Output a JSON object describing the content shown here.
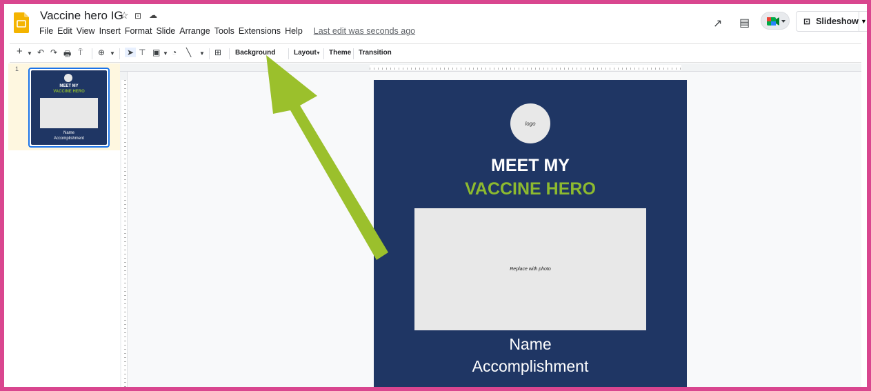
{
  "header": {
    "title": "Vaccine hero IG",
    "menu": [
      "File",
      "Edit",
      "View",
      "Insert",
      "Format",
      "Slide",
      "Arrange",
      "Tools",
      "Extensions",
      "Help"
    ],
    "last_edit": "Last edit was seconds ago",
    "slideshow_label": "Slideshow"
  },
  "toolbar": {
    "background_label": "Background",
    "layout_label": "Layout",
    "theme_label": "Theme",
    "transition_label": "Transition"
  },
  "filmstrip": {
    "slide_number": "1",
    "thumb_title1": "MEET MY",
    "thumb_title2": "VACCINE HERO",
    "thumb_caption1": "Name",
    "thumb_caption2": "Accomplishment"
  },
  "slide": {
    "logo_text": "logo",
    "title1": "MEET MY",
    "title2": "VACCINE HERO",
    "photo_placeholder": "Replace with photo",
    "name": "Name",
    "accomplishment": "Accomplishment"
  },
  "colors": {
    "frame": "#d9468f",
    "slide_bg": "#1f3664",
    "accent_green": "#8dba2f",
    "arrow": "#9bc02c"
  },
  "icons": [
    "slides-logo-icon",
    "star-icon",
    "folder-icon",
    "cloud-icon",
    "trend-icon",
    "comment-icon",
    "meet-icon",
    "present-icon"
  ]
}
